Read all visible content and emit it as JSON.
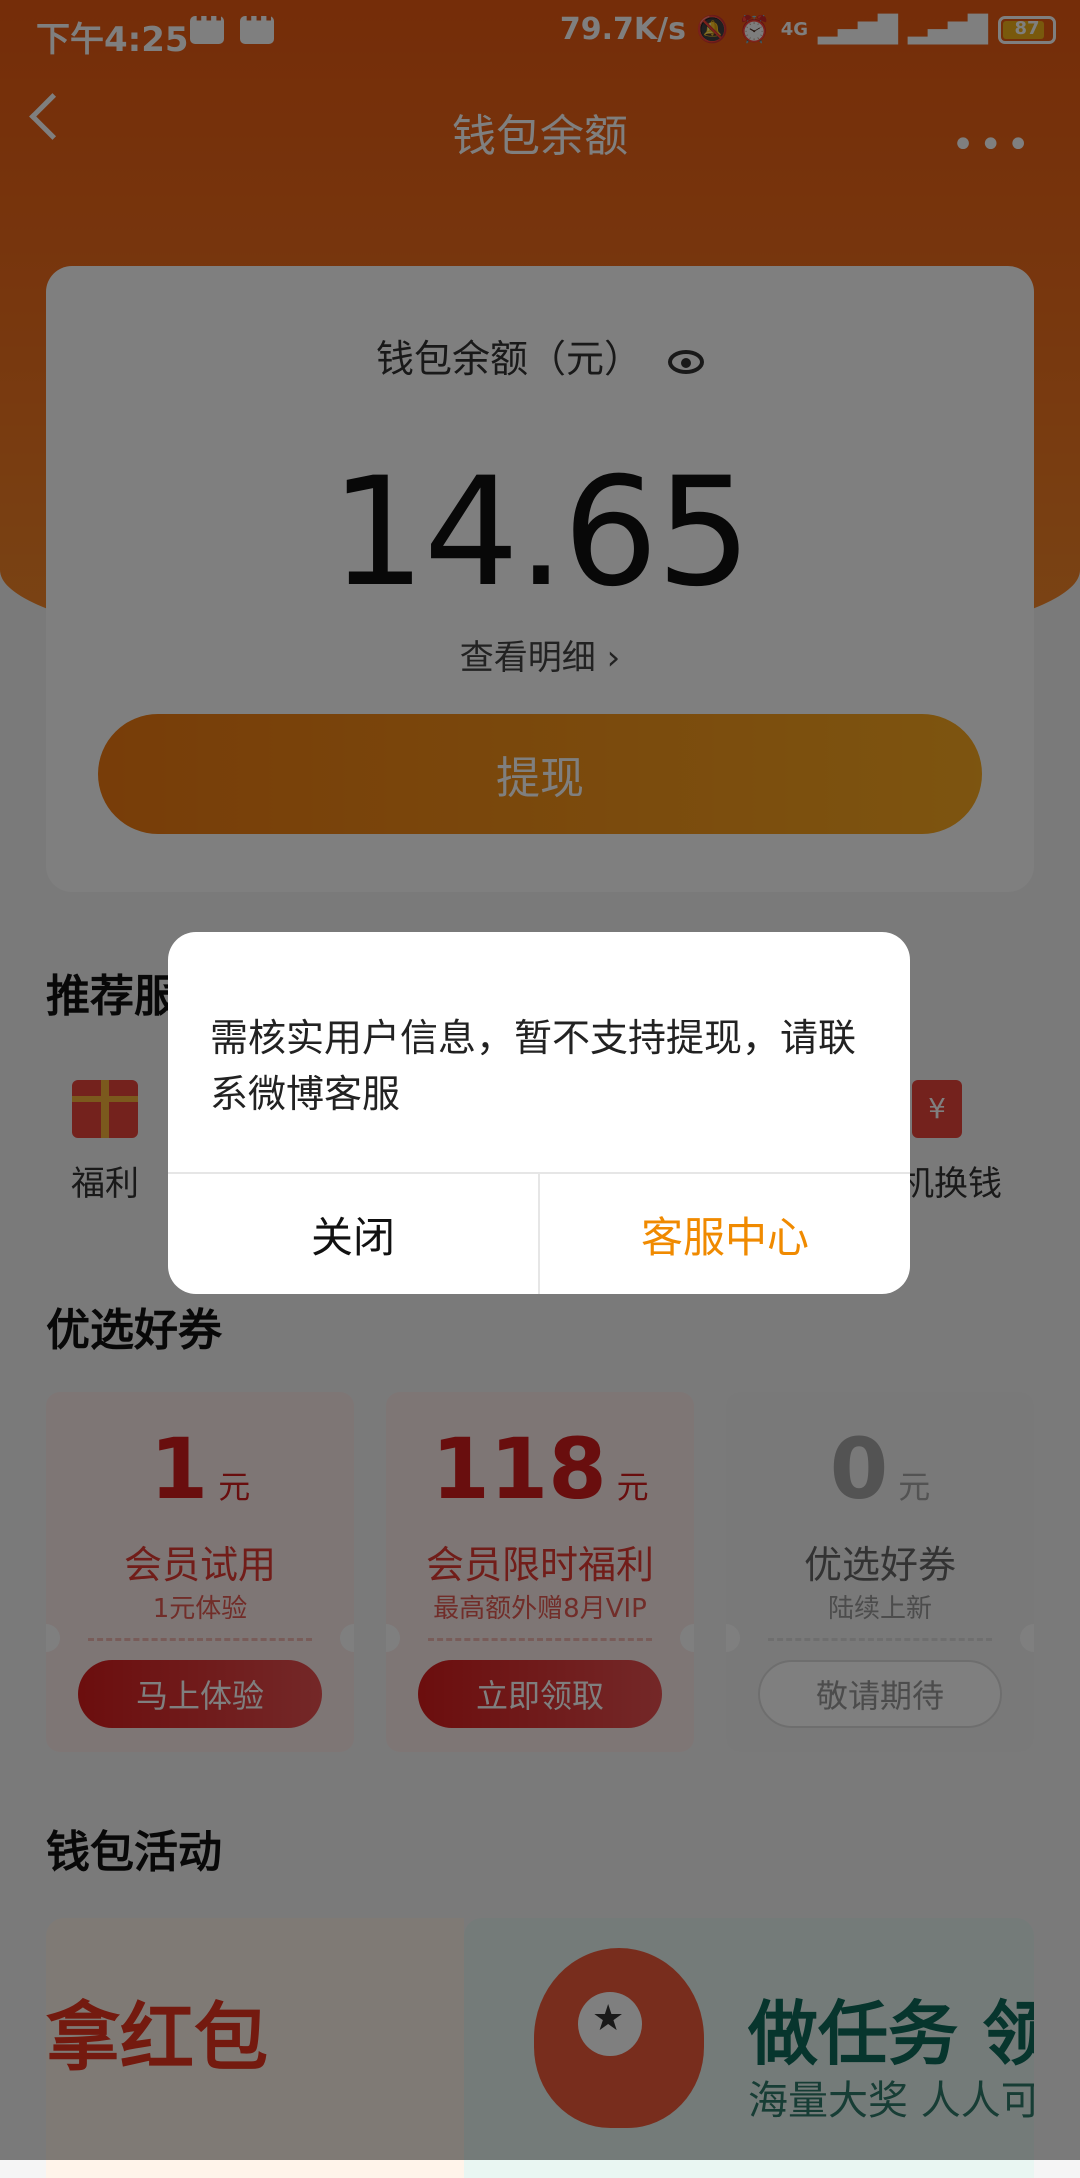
{
  "status_bar": {
    "time": "下午4:25",
    "speed": "79.7K/s",
    "network": "4G",
    "battery": "87",
    "battery_level": 0.87
  },
  "nav": {
    "title": "钱包余额"
  },
  "balance": {
    "label": "钱包余额（元）",
    "amount": "14.65",
    "detail": "查看明细 ›",
    "withdraw": "提现"
  },
  "services": {
    "title": "推荐服",
    "items": [
      {
        "label": "福利",
        "icon": "gift-icon"
      },
      {
        "label": "机换钱",
        "icon": "exchange-icon"
      }
    ]
  },
  "coupons": {
    "title": "优选好券",
    "items": [
      {
        "value": "1",
        "unit": "元",
        "name": "会员试用",
        "sub": "1元体验",
        "button": "马上体验"
      },
      {
        "value": "118",
        "unit": "元",
        "name": "会员限时福利",
        "sub": "最高额外赠8月VIP",
        "button": "立即领取"
      },
      {
        "value": "0",
        "unit": "元",
        "name": "优选好券",
        "sub": "陆续上新",
        "button": "敬请期待"
      }
    ]
  },
  "activities": {
    "title": "钱包活动",
    "banner1": "拿红包",
    "banner2_title": "做任务 领",
    "banner2_sub": "海量大奖 人人可"
  },
  "dialog": {
    "message": "需核实用户信息，暂不支持提现，请联系微博客服",
    "close": "关闭",
    "service": "客服中心"
  },
  "colors": {
    "accent": "#f08a00",
    "hero": "#ea5a12",
    "coupon_red": "#d21c1c"
  }
}
